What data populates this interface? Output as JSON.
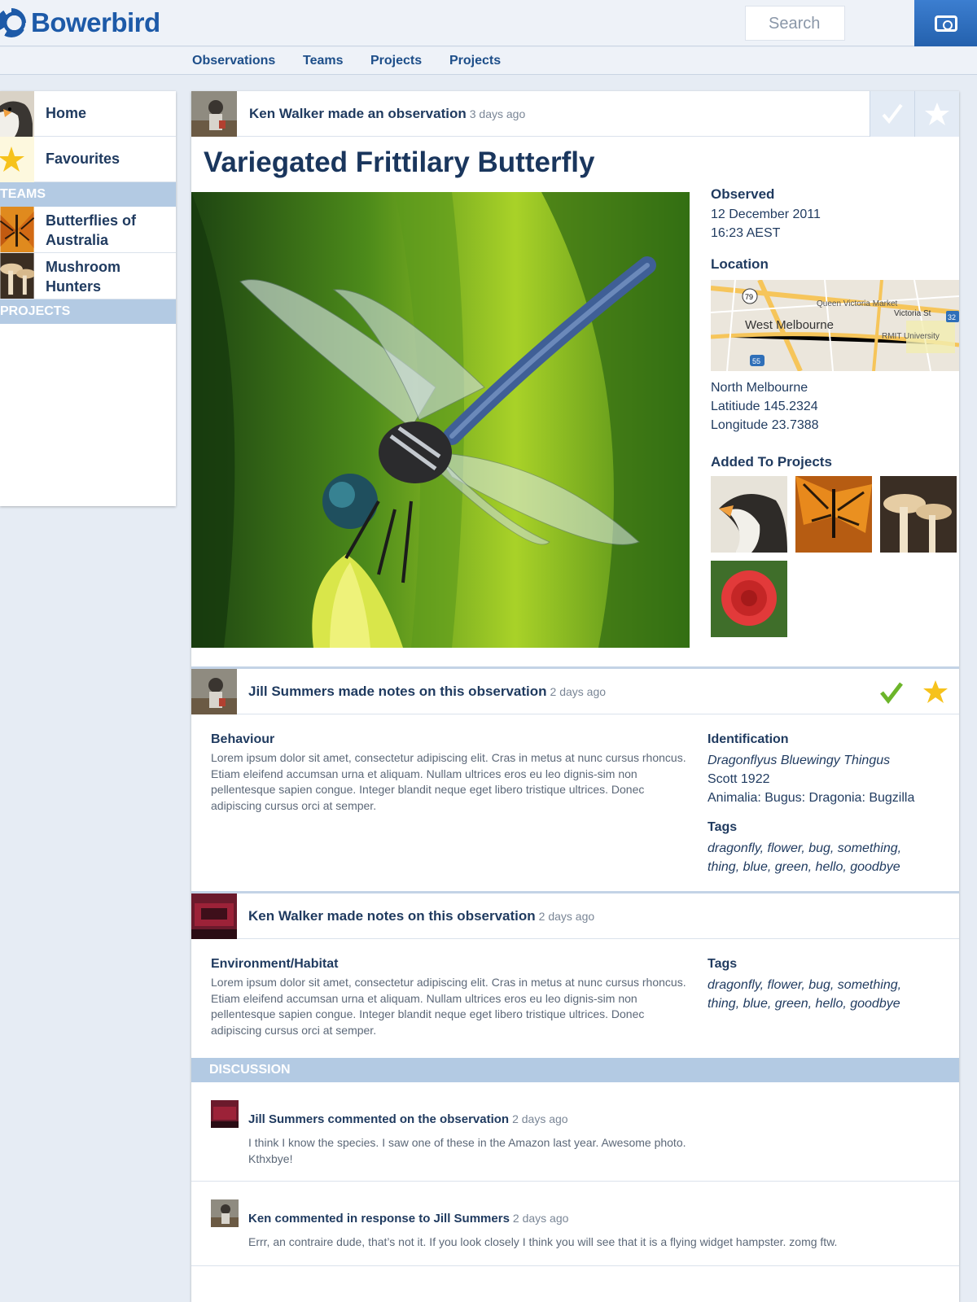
{
  "app": {
    "name": "Bowerbird"
  },
  "header": {
    "search_placeholder": "Search",
    "camera_icon": "camera-icon",
    "accent": "#2461ad"
  },
  "nav": [
    "Observations",
    "Teams",
    "Projects",
    "Projects"
  ],
  "sidebar": {
    "home": "Home",
    "favourites": "Favourites",
    "teams_header": "TEAMS",
    "teams": [
      "Butterflies of Australia",
      "Mushroom Hunters"
    ],
    "projects_header": "PROJECTS"
  },
  "observation": {
    "author_line": "Ken Walker made an observation",
    "time": "3 days ago",
    "title": "Variegated Frittilary Butterfly",
    "observed_label": "Observed",
    "observed_date": "12 December 2011",
    "observed_time": "16:23 AEST",
    "location_label": "Location",
    "map_labels": [
      "West Melbourne",
      "Queen Victoria Market",
      "Victoria St",
      "RMIT University",
      "79",
      "55",
      "32"
    ],
    "location_name": "North  Melbourne",
    "latitude": "Latitiude 145.2324",
    "longitude": "Longitude 23.7388",
    "projects_label": "Added To Projects"
  },
  "note1": {
    "author_line": "Jill Summers made notes on this observation",
    "time": "2 days ago",
    "behaviour_label": "Behaviour",
    "behaviour_text": "Lorem ipsum dolor sit amet, consectetur adipiscing elit. Cras in metus at nunc cursus rhoncus. Etiam eleifend accumsan urna et aliquam. Nullam ultrices eros eu leo dignis-sim non pellentesque sapien congue. Integer blandit neque eget libero tristique ultrices. Donec adipiscing cursus orci at semper.",
    "identification_label": "Identification",
    "species": "Dragonflyus Bluewingy Thingus",
    "author_year": "Scott 1922",
    "taxonomy": "Animalia: Bugus: Dragonia: Bugzilla",
    "tags_label": "Tags",
    "tags": "dragonfly, flower, bug, something, thing, blue, green, hello, goodbye"
  },
  "note2": {
    "author_line": "Ken Walker made notes on this observation",
    "time": "2 days ago",
    "habitat_label": "Environment/Habitat",
    "habitat_text": "Lorem ipsum dolor sit amet, consectetur adipiscing elit. Cras in metus at nunc cursus rhoncus. Etiam eleifend accumsan urna et aliquam. Nullam ultrices eros eu leo dignis-sim non pellentesque sapien congue. Integer blandit neque eget libero tristique ultrices. Donec adipiscing cursus orci at semper.",
    "tags_label": "Tags",
    "tags": "dragonfly, flower, bug, something, thing, blue, green, hello, goodbye"
  },
  "discussion": {
    "header": "DISCUSSION",
    "comments": [
      {
        "author_line": "Jill Summers commented on the observation",
        "time": "2 days ago",
        "text": "I think I know the species. I saw one of these in the Amazon last year. Awesome photo. Kthxbye!"
      },
      {
        "author_line": "Ken commented in response to Jill Summers",
        "time": "2 days ago",
        "text": "Errr, an contraire dude, that’s not it. If you look closely I think you will see that it is a flying widget hampster. zomg ftw."
      }
    ]
  }
}
